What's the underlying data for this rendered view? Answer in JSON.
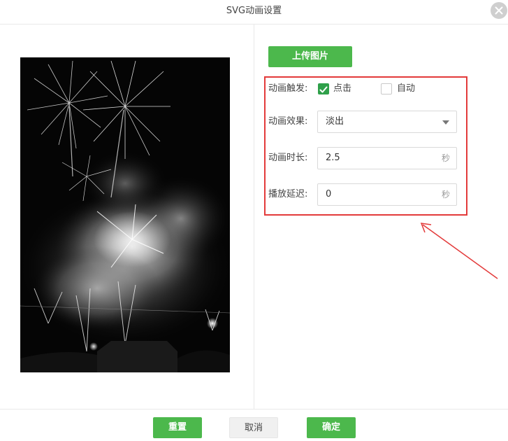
{
  "dialog": {
    "title": "SVG动画设置",
    "close_icon": "close-icon"
  },
  "preview": {
    "description_icon": "fireworks-image"
  },
  "upload": {
    "label": "上传图片"
  },
  "form": {
    "trigger": {
      "label": "动画触发:",
      "options": [
        {
          "label": "点击",
          "checked": true
        },
        {
          "label": "自动",
          "checked": false
        }
      ]
    },
    "effect": {
      "label": "动画效果:",
      "value": "淡出"
    },
    "duration": {
      "label": "动画时长:",
      "value": "2.5",
      "unit": "秒"
    },
    "delay": {
      "label": "播放延迟:",
      "value": "0",
      "unit": "秒"
    }
  },
  "footer": {
    "reset_label": "重置",
    "cancel_label": "取消",
    "confirm_label": "确定"
  },
  "colors": {
    "accent": "#4cb84c",
    "highlight": "#e33a3a",
    "check": "#2fa04a"
  }
}
